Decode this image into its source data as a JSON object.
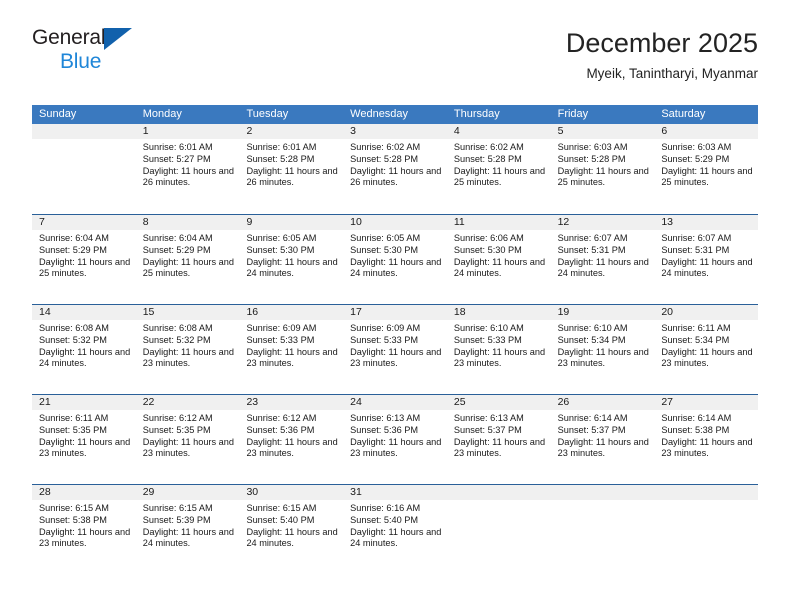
{
  "brand": {
    "name_top": "General",
    "name_bottom": "Blue",
    "triangle_color": "#1161ac",
    "blue_color": "#1f86d8"
  },
  "header": {
    "title": "December 2025",
    "location": "Myeik, Tanintharyi, Myanmar"
  },
  "theme": {
    "header_blue": "#3a79bf",
    "row_divider_blue": "#2a6099",
    "daynum_gray": "#f0f0f0"
  },
  "weekdays": [
    "Sunday",
    "Monday",
    "Tuesday",
    "Wednesday",
    "Thursday",
    "Friday",
    "Saturday"
  ],
  "labels": {
    "sunrise_prefix": "Sunrise: ",
    "sunset_prefix": "Sunset: ",
    "daylight_prefix": "Daylight: "
  },
  "weeks": [
    [
      {
        "day": "",
        "sunrise": "",
        "sunset": "",
        "daylight": ""
      },
      {
        "day": "1",
        "sunrise": "Sunrise: 6:01 AM",
        "sunset": "Sunset: 5:27 PM",
        "daylight": "Daylight: 11 hours and 26 minutes."
      },
      {
        "day": "2",
        "sunrise": "Sunrise: 6:01 AM",
        "sunset": "Sunset: 5:28 PM",
        "daylight": "Daylight: 11 hours and 26 minutes."
      },
      {
        "day": "3",
        "sunrise": "Sunrise: 6:02 AM",
        "sunset": "Sunset: 5:28 PM",
        "daylight": "Daylight: 11 hours and 26 minutes."
      },
      {
        "day": "4",
        "sunrise": "Sunrise: 6:02 AM",
        "sunset": "Sunset: 5:28 PM",
        "daylight": "Daylight: 11 hours and 25 minutes."
      },
      {
        "day": "5",
        "sunrise": "Sunrise: 6:03 AM",
        "sunset": "Sunset: 5:28 PM",
        "daylight": "Daylight: 11 hours and 25 minutes."
      },
      {
        "day": "6",
        "sunrise": "Sunrise: 6:03 AM",
        "sunset": "Sunset: 5:29 PM",
        "daylight": "Daylight: 11 hours and 25 minutes."
      }
    ],
    [
      {
        "day": "7",
        "sunrise": "Sunrise: 6:04 AM",
        "sunset": "Sunset: 5:29 PM",
        "daylight": "Daylight: 11 hours and 25 minutes."
      },
      {
        "day": "8",
        "sunrise": "Sunrise: 6:04 AM",
        "sunset": "Sunset: 5:29 PM",
        "daylight": "Daylight: 11 hours and 25 minutes."
      },
      {
        "day": "9",
        "sunrise": "Sunrise: 6:05 AM",
        "sunset": "Sunset: 5:30 PM",
        "daylight": "Daylight: 11 hours and 24 minutes."
      },
      {
        "day": "10",
        "sunrise": "Sunrise: 6:05 AM",
        "sunset": "Sunset: 5:30 PM",
        "daylight": "Daylight: 11 hours and 24 minutes."
      },
      {
        "day": "11",
        "sunrise": "Sunrise: 6:06 AM",
        "sunset": "Sunset: 5:30 PM",
        "daylight": "Daylight: 11 hours and 24 minutes."
      },
      {
        "day": "12",
        "sunrise": "Sunrise: 6:07 AM",
        "sunset": "Sunset: 5:31 PM",
        "daylight": "Daylight: 11 hours and 24 minutes."
      },
      {
        "day": "13",
        "sunrise": "Sunrise: 6:07 AM",
        "sunset": "Sunset: 5:31 PM",
        "daylight": "Daylight: 11 hours and 24 minutes."
      }
    ],
    [
      {
        "day": "14",
        "sunrise": "Sunrise: 6:08 AM",
        "sunset": "Sunset: 5:32 PM",
        "daylight": "Daylight: 11 hours and 24 minutes."
      },
      {
        "day": "15",
        "sunrise": "Sunrise: 6:08 AM",
        "sunset": "Sunset: 5:32 PM",
        "daylight": "Daylight: 11 hours and 23 minutes."
      },
      {
        "day": "16",
        "sunrise": "Sunrise: 6:09 AM",
        "sunset": "Sunset: 5:33 PM",
        "daylight": "Daylight: 11 hours and 23 minutes."
      },
      {
        "day": "17",
        "sunrise": "Sunrise: 6:09 AM",
        "sunset": "Sunset: 5:33 PM",
        "daylight": "Daylight: 11 hours and 23 minutes."
      },
      {
        "day": "18",
        "sunrise": "Sunrise: 6:10 AM",
        "sunset": "Sunset: 5:33 PM",
        "daylight": "Daylight: 11 hours and 23 minutes."
      },
      {
        "day": "19",
        "sunrise": "Sunrise: 6:10 AM",
        "sunset": "Sunset: 5:34 PM",
        "daylight": "Daylight: 11 hours and 23 minutes."
      },
      {
        "day": "20",
        "sunrise": "Sunrise: 6:11 AM",
        "sunset": "Sunset: 5:34 PM",
        "daylight": "Daylight: 11 hours and 23 minutes."
      }
    ],
    [
      {
        "day": "21",
        "sunrise": "Sunrise: 6:11 AM",
        "sunset": "Sunset: 5:35 PM",
        "daylight": "Daylight: 11 hours and 23 minutes."
      },
      {
        "day": "22",
        "sunrise": "Sunrise: 6:12 AM",
        "sunset": "Sunset: 5:35 PM",
        "daylight": "Daylight: 11 hours and 23 minutes."
      },
      {
        "day": "23",
        "sunrise": "Sunrise: 6:12 AM",
        "sunset": "Sunset: 5:36 PM",
        "daylight": "Daylight: 11 hours and 23 minutes."
      },
      {
        "day": "24",
        "sunrise": "Sunrise: 6:13 AM",
        "sunset": "Sunset: 5:36 PM",
        "daylight": "Daylight: 11 hours and 23 minutes."
      },
      {
        "day": "25",
        "sunrise": "Sunrise: 6:13 AM",
        "sunset": "Sunset: 5:37 PM",
        "daylight": "Daylight: 11 hours and 23 minutes."
      },
      {
        "day": "26",
        "sunrise": "Sunrise: 6:14 AM",
        "sunset": "Sunset: 5:37 PM",
        "daylight": "Daylight: 11 hours and 23 minutes."
      },
      {
        "day": "27",
        "sunrise": "Sunrise: 6:14 AM",
        "sunset": "Sunset: 5:38 PM",
        "daylight": "Daylight: 11 hours and 23 minutes."
      }
    ],
    [
      {
        "day": "28",
        "sunrise": "Sunrise: 6:15 AM",
        "sunset": "Sunset: 5:38 PM",
        "daylight": "Daylight: 11 hours and 23 minutes."
      },
      {
        "day": "29",
        "sunrise": "Sunrise: 6:15 AM",
        "sunset": "Sunset: 5:39 PM",
        "daylight": "Daylight: 11 hours and 24 minutes."
      },
      {
        "day": "30",
        "sunrise": "Sunrise: 6:15 AM",
        "sunset": "Sunset: 5:40 PM",
        "daylight": "Daylight: 11 hours and 24 minutes."
      },
      {
        "day": "31",
        "sunrise": "Sunrise: 6:16 AM",
        "sunset": "Sunset: 5:40 PM",
        "daylight": "Daylight: 11 hours and 24 minutes."
      },
      {
        "day": "",
        "sunrise": "",
        "sunset": "",
        "daylight": ""
      },
      {
        "day": "",
        "sunrise": "",
        "sunset": "",
        "daylight": ""
      },
      {
        "day": "",
        "sunrise": "",
        "sunset": "",
        "daylight": ""
      }
    ]
  ]
}
